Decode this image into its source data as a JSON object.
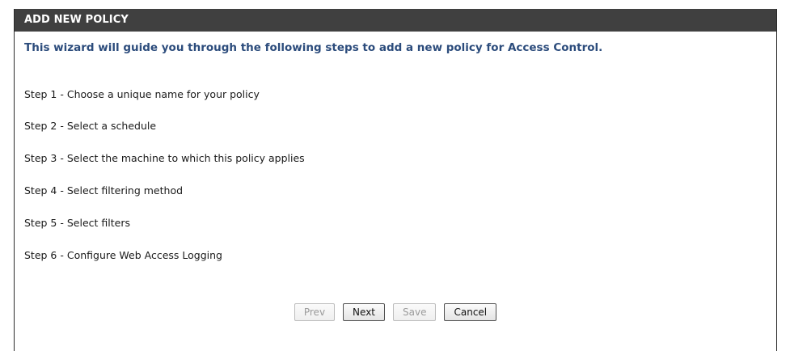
{
  "header": {
    "title": "ADD NEW POLICY"
  },
  "intro": "This wizard will guide you through the following steps to add a new policy for Access Control.",
  "steps": [
    "Step 1 - Choose a unique name for your policy",
    "Step 2 - Select a schedule",
    "Step 3 - Select the machine to which this policy applies",
    "Step 4 - Select filtering method",
    "Step 5 - Select filters",
    "Step 6 - Configure Web Access Logging"
  ],
  "buttons": {
    "prev": "Prev",
    "next": "Next",
    "save": "Save",
    "cancel": "Cancel"
  },
  "colors": {
    "header_bg": "#404040",
    "intro_text": "#2c4c7c"
  }
}
